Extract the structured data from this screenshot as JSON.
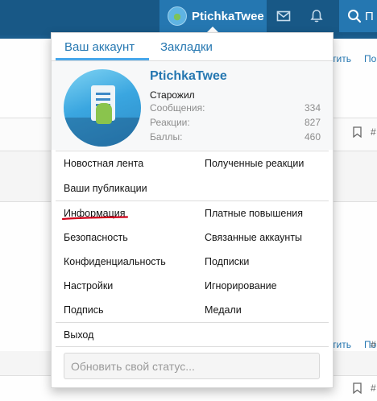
{
  "nav": {
    "account_name": "PtichkaTwee",
    "search_label": "П"
  },
  "background": {
    "link_1": "тить",
    "link_2": "По",
    "link_3": "тить",
    "link_4": "По",
    "hash_1": "#",
    "hash_2": "#",
    "hash_3": "#"
  },
  "menu": {
    "tabs": [
      "Ваш аккаунт",
      "Закладки"
    ],
    "profile": {
      "username": "PtichkaTwee",
      "rank": "Старожил",
      "stats": [
        {
          "label": "Сообщения:",
          "value": "334"
        },
        {
          "label": "Реакции:",
          "value": "827"
        },
        {
          "label": "Баллы:",
          "value": "460"
        }
      ]
    },
    "left_items": [
      "Новостная лента",
      "Ваши публикации",
      "Информация",
      "Безопасность",
      "Конфиденциальность",
      "Настройки",
      "Подпись"
    ],
    "right_items": [
      "Полученные реакции",
      "Платные повышения",
      "Связанные аккаунты",
      "Подписки",
      "Игнорирование",
      "Медали"
    ],
    "logout": "Выход",
    "status_placeholder": "Обновить свой статус..."
  },
  "colors": {
    "nav_bg": "#185886",
    "nav_active": "#2577b1",
    "link": "#2577b1",
    "tab_underline": "#47a7eb",
    "annotation": "#d0021b"
  }
}
